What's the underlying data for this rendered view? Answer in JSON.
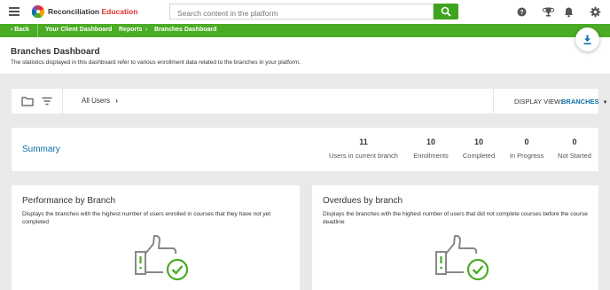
{
  "topbar": {
    "brand_main": "Reconciliation",
    "brand_accent": "Education",
    "search_placeholder": "Search content in the platform",
    "icons": [
      "hamburger-menu-icon",
      "search-icon",
      "help-icon",
      "trophy-icon",
      "bell-icon",
      "gear-icon"
    ]
  },
  "breadcrumb": {
    "back_label": "Back",
    "items": [
      "Your Client Dashboard",
      "Reports",
      "Branches Dashboard"
    ],
    "separator": "›"
  },
  "header": {
    "title": "Branches Dashboard",
    "description": "The statistics displayed in this dashboard refer to various enrollment data related to the branches in your platform."
  },
  "filterbar": {
    "all_users_label": "All Users",
    "display_view_label": "DISPLAY VIEW:",
    "display_view_value": "BRANCHES"
  },
  "summary": {
    "title": "Summary",
    "stats": [
      {
        "value": "11",
        "label": "Users in current branch"
      },
      {
        "value": "10",
        "label": "Enrollments"
      },
      {
        "value": "10",
        "label": "Completed"
      },
      {
        "value": "0",
        "label": "In Progress"
      },
      {
        "value": "0",
        "label": "Not Started"
      }
    ]
  },
  "cards": [
    {
      "title": "Performance by Branch",
      "description": "Displays the branches with the highest number of users enrolled in courses that they have not yet completed"
    },
    {
      "title": "Overdues by branch",
      "description": "Displays the branches with the highest number of users that did not complete courses before the course deadline"
    }
  ],
  "colors": {
    "green": "#4aab24",
    "search_green": "#40a31f",
    "link_blue": "#0d70a6",
    "brand_red": "#e3312d",
    "background": "#e9e9e9"
  }
}
